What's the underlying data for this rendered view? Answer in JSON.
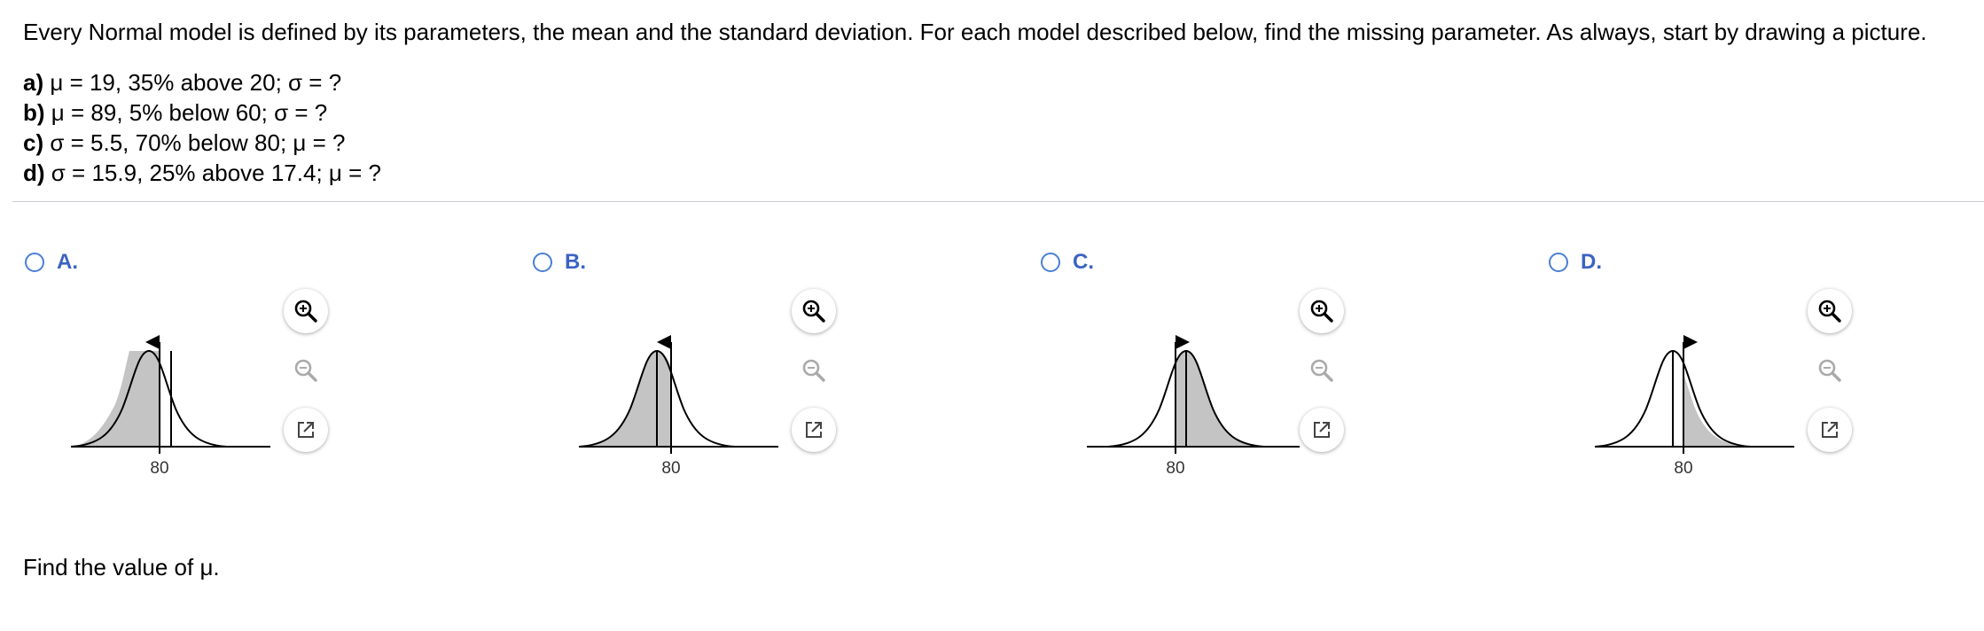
{
  "question": {
    "intro": "Every Normal model is defined by its parameters, the mean and the standard deviation. For each model described below, find the missing parameter. As always, start by drawing a picture.",
    "parts": [
      {
        "letter": "a)",
        "text": "μ = 19, 35% above 20; σ = ?"
      },
      {
        "letter": "b)",
        "text": "μ = 89, 5% below 60; σ = ?"
      },
      {
        "letter": "c)",
        "text": "σ = 5.5, 70% below 80; μ = ?"
      },
      {
        "letter": "d)",
        "text": "σ = 15.9, 25% above 17.4; μ = ?"
      }
    ],
    "footer": "Find the value of μ."
  },
  "options": [
    {
      "label": "A.",
      "tick_label": "80",
      "shading": "left of 80",
      "mean_side": "right of 80",
      "flag_direction": "left"
    },
    {
      "label": "B.",
      "tick_label": "80",
      "shading": "left of 80",
      "mean_side": "left of 80",
      "flag_direction": "left"
    },
    {
      "label": "C.",
      "tick_label": "80",
      "shading": "right of 80",
      "mean_side": "right of 80",
      "flag_direction": "right"
    },
    {
      "label": "D.",
      "tick_label": "80",
      "shading": "right of 80",
      "mean_side": "left of 80",
      "flag_direction": "right"
    }
  ],
  "tools": {
    "zoom_in_icon": "zoom-in-icon",
    "zoom_out_icon": "zoom-out-icon",
    "popout_icon": "popout-icon"
  },
  "colors": {
    "radio_border": "#4a7fd6",
    "option_label": "#3a63c4",
    "shade_fill": "#c4c4c4",
    "divider": "#c9cdd6"
  }
}
